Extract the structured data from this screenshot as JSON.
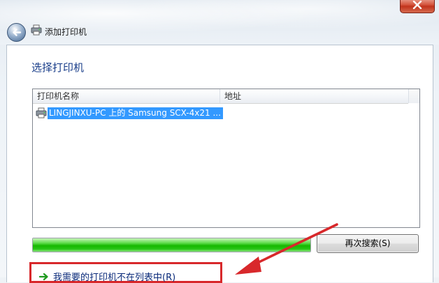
{
  "window": {
    "title": "添加打印机",
    "accent": "#1a3e8a"
  },
  "page": {
    "heading": "选择打印机"
  },
  "printer_list": {
    "columns": [
      "打印机名称",
      "地址"
    ],
    "rows": [
      {
        "name": "LINGJINXU-PC 上的 Samsung SCX-4x21 ...",
        "address": "",
        "selected": true
      }
    ]
  },
  "search": {
    "progress_percent": 100,
    "search_again_label": "再次搜索(S)"
  },
  "footer": {
    "not_listed_link": "我需要的打印机不在列表中(R)"
  },
  "icons": {
    "back": "back-arrow-icon",
    "window": "printer-icon",
    "row": "printer-icon",
    "link": "green-arrow-icon"
  }
}
